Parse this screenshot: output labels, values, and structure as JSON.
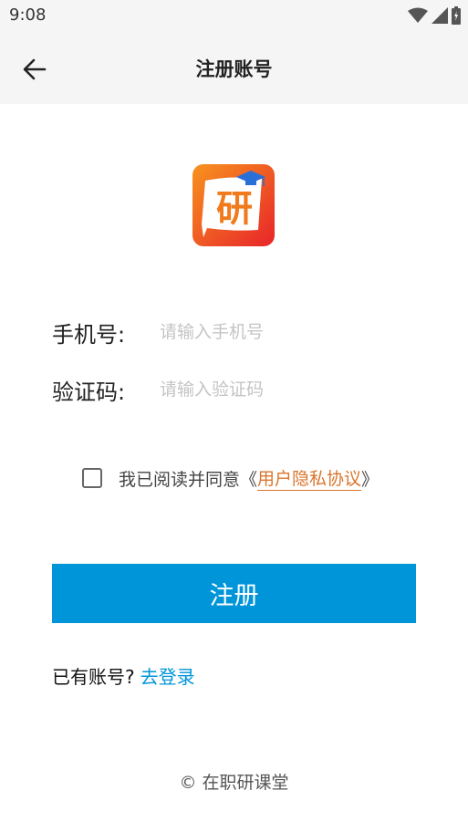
{
  "status_bar": {
    "time": "9:08"
  },
  "app_bar": {
    "title": "注册账号"
  },
  "form": {
    "phone_label": "手机号:",
    "phone_placeholder": "请输入手机号",
    "code_label": "验证码:",
    "code_placeholder": "请输入验证码"
  },
  "agreement": {
    "checked": false,
    "text": "我已阅读并同意",
    "open_bracket": "《",
    "link_label": "用户隐私协议",
    "close_bracket": "》"
  },
  "register_button": "注册",
  "login": {
    "prompt": "已有账号?",
    "link": "去登录"
  },
  "footer": {
    "copyright": "© 在职研课堂"
  },
  "logo": {
    "text": "研",
    "icon": "graduation-cap-icon"
  },
  "colors": {
    "accent": "#0095d9",
    "link_orange": "#d9752c",
    "app_bar_bg": "#f5f5f5"
  }
}
